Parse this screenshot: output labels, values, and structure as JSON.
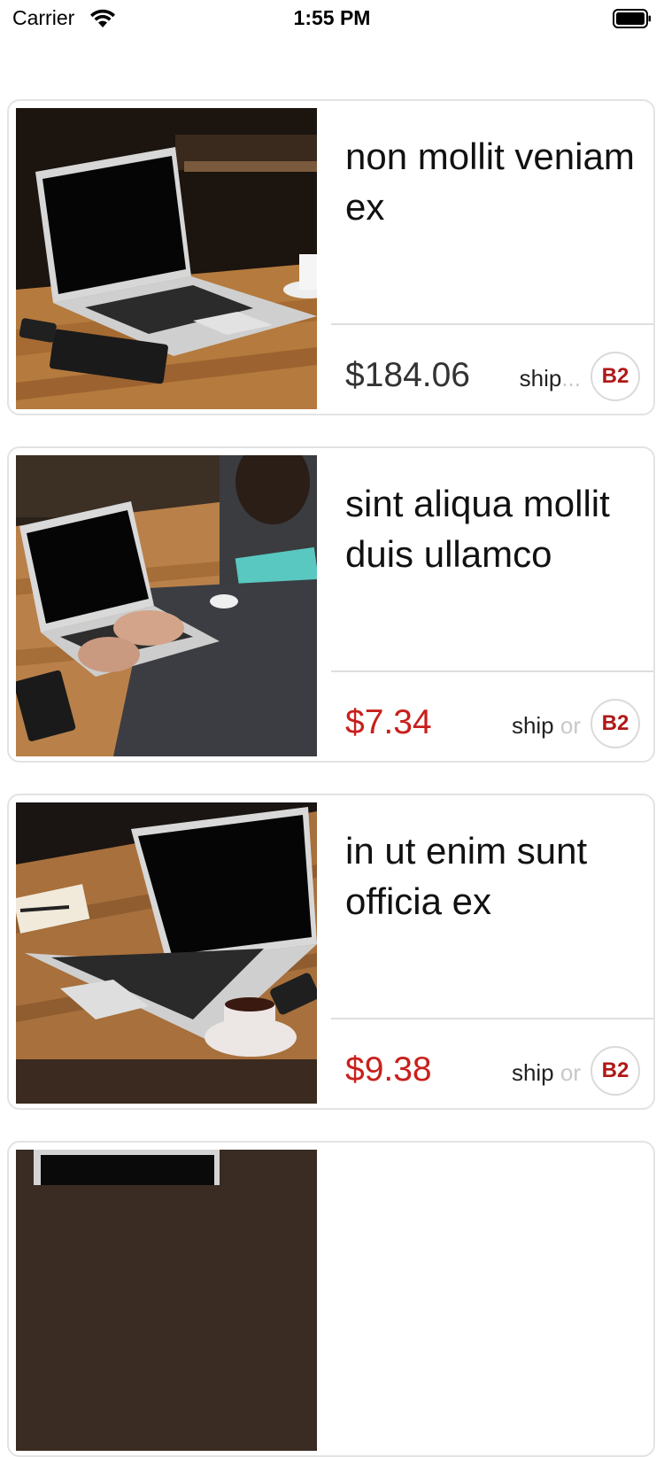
{
  "status_bar": {
    "carrier": "Carrier",
    "time": "1:55 PM"
  },
  "products": [
    {
      "title": "non mollit veniam ex",
      "price": "$184.06",
      "price_style": "normal",
      "ship": "ship",
      "ship_overflow": "...",
      "badge": "B2"
    },
    {
      "title": "sint aliqua mollit duis ullamco",
      "price": "$7.34",
      "price_style": "sale",
      "ship": "ship",
      "or": "or",
      "badge": "B2"
    },
    {
      "title": "in ut enim sunt officia ex",
      "price": "$9.38",
      "price_style": "sale",
      "ship": "ship",
      "or": "or",
      "badge": "B2"
    }
  ],
  "colors": {
    "sale_price": "#c8201c",
    "badge_text": "#b01818",
    "card_border": "#e3e3e3"
  },
  "icons": [
    "wifi-icon",
    "battery-icon",
    "product-photo-laptop"
  ]
}
